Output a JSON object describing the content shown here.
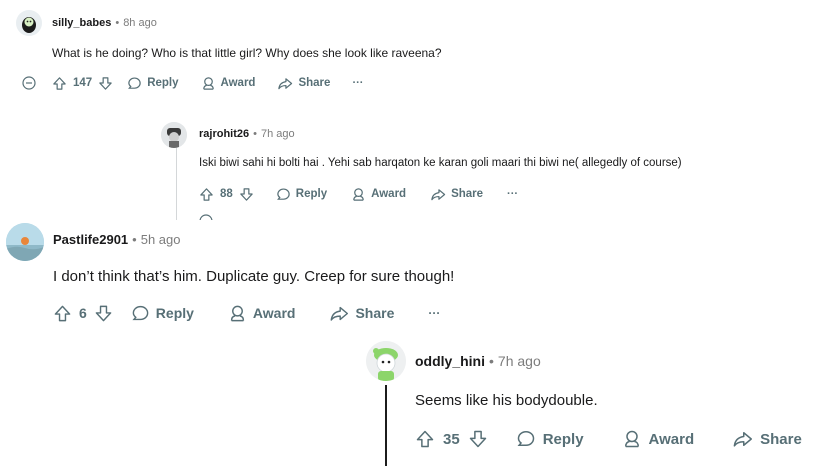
{
  "comments": [
    {
      "user": "silly_babes",
      "time": "8h ago",
      "text": "What is he doing? Who is that little girl? Why does she look like raveena?",
      "votes": "147",
      "reply": "Reply",
      "award": "Award",
      "share": "Share",
      "more": "···"
    },
    {
      "user": "rajrohit26",
      "time": "7h ago",
      "text": "Iski biwi sahi hi bolti hai . Yehi sab harqaton ke karan goli maari thi biwi ne( allegedly of course)",
      "votes": "88",
      "reply": "Reply",
      "award": "Award",
      "share": "Share",
      "more": "···"
    },
    {
      "user": "Pastlife2901",
      "time": "5h ago",
      "text": "I don’t think that’s him. Duplicate guy. Creep for sure though!",
      "votes": "6",
      "reply": "Reply",
      "award": "Award",
      "share": "Share",
      "more": "···"
    },
    {
      "user": "oddly_hini",
      "time": "7h ago",
      "text": "Seems like his bodydouble.",
      "votes": "35",
      "reply": "Reply",
      "award": "Award",
      "share": "Share"
    }
  ],
  "separator": "•",
  "colors": {
    "meta_gray": "#7c7c7c",
    "action_gray": "#576f76",
    "thread_line": "#d4d7d9",
    "avatar_green": "#8cd56a"
  }
}
